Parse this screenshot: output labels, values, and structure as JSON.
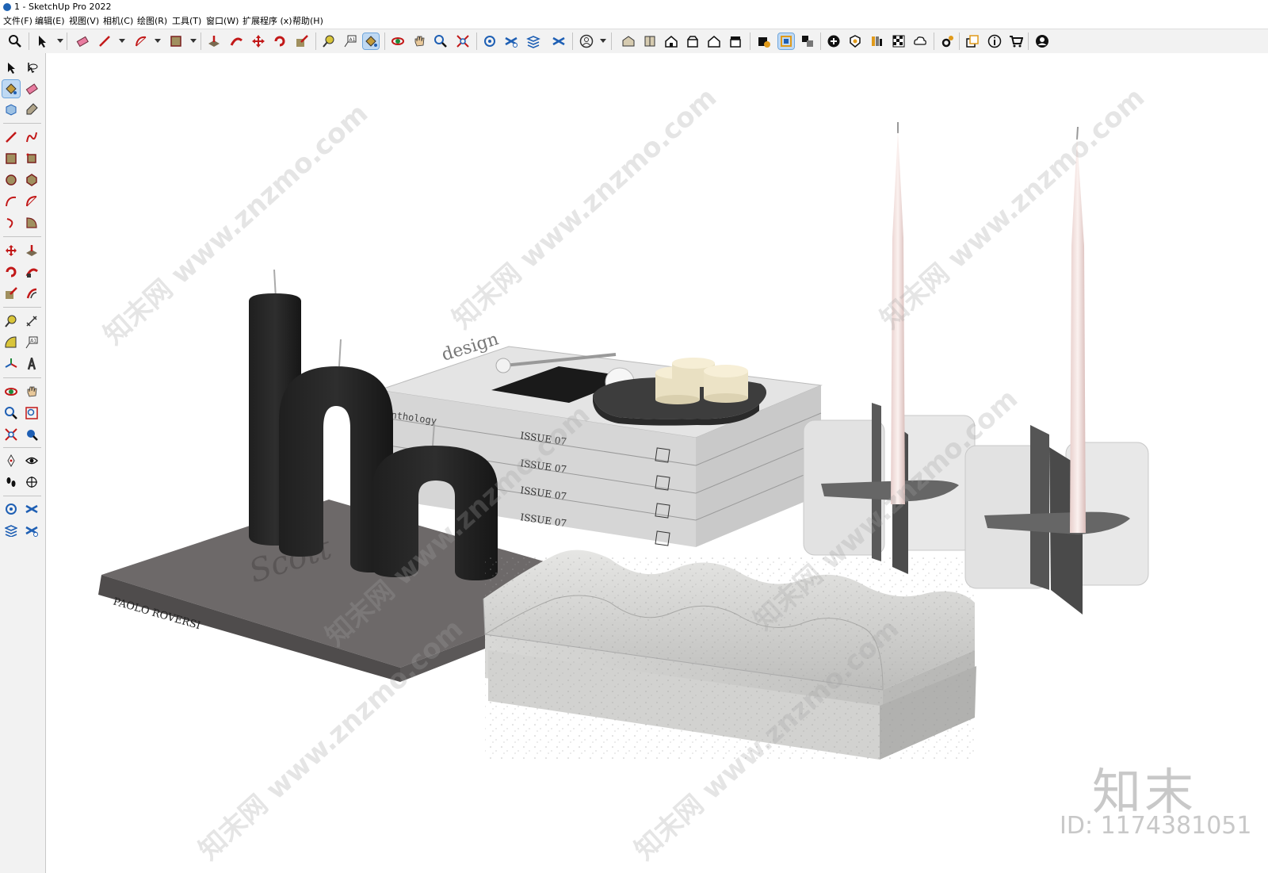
{
  "window": {
    "title": "1 - SketchUp Pro 2022"
  },
  "menu": [
    "文件(F)",
    "编辑(E)",
    "视图(V)",
    "相机(C)",
    "绘图(R)",
    "工具(T)",
    "窗口(W)",
    "扩展程序 (x)",
    "帮助(H)"
  ],
  "book_label": "PAOLO ROVERSI",
  "book_script": "Scott",
  "magazine": {
    "cover_text": "design",
    "subtitle": "anthology",
    "issue": "ISSUE 07"
  },
  "watermark": {
    "logo": "知末",
    "id": "ID: 1174381051",
    "site": "www.znzmo.com",
    "brand": "知末网"
  },
  "active_tools": [
    "paint-bucket",
    "orbit"
  ]
}
